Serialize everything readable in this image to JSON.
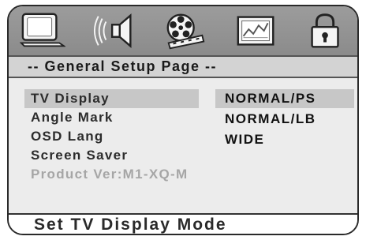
{
  "icons": [
    {
      "name": "tv-icon",
      "label": "General Setup"
    },
    {
      "name": "speaker-icon",
      "label": "Audio Setup"
    },
    {
      "name": "film-reel-icon",
      "label": "Video Setup"
    },
    {
      "name": "chart-icon",
      "label": "Preference"
    },
    {
      "name": "lock-icon",
      "label": "Password"
    }
  ],
  "page_title": "-- General Setup Page --",
  "menu": [
    {
      "label": "TV Display",
      "selected": true,
      "disabled": false
    },
    {
      "label": "Angle Mark",
      "selected": false,
      "disabled": false
    },
    {
      "label": "OSD Lang",
      "selected": false,
      "disabled": false
    },
    {
      "label": "Screen Saver",
      "selected": false,
      "disabled": false
    },
    {
      "label": "Product Ver:M1-XQ-M",
      "selected": false,
      "disabled": true
    }
  ],
  "options": [
    {
      "label": "NORMAL/PS",
      "selected": true
    },
    {
      "label": "NORMAL/LB",
      "selected": false
    },
    {
      "label": "WIDE",
      "selected": false
    }
  ],
  "status": "Set TV Display Mode",
  "colors": {
    "icon_bar": "#8b8b8b",
    "title_bar": "#d3d3d3",
    "menu_background": "#ececec",
    "highlight": "#c7c7c7",
    "disabled_text": "#a6a6a6"
  }
}
